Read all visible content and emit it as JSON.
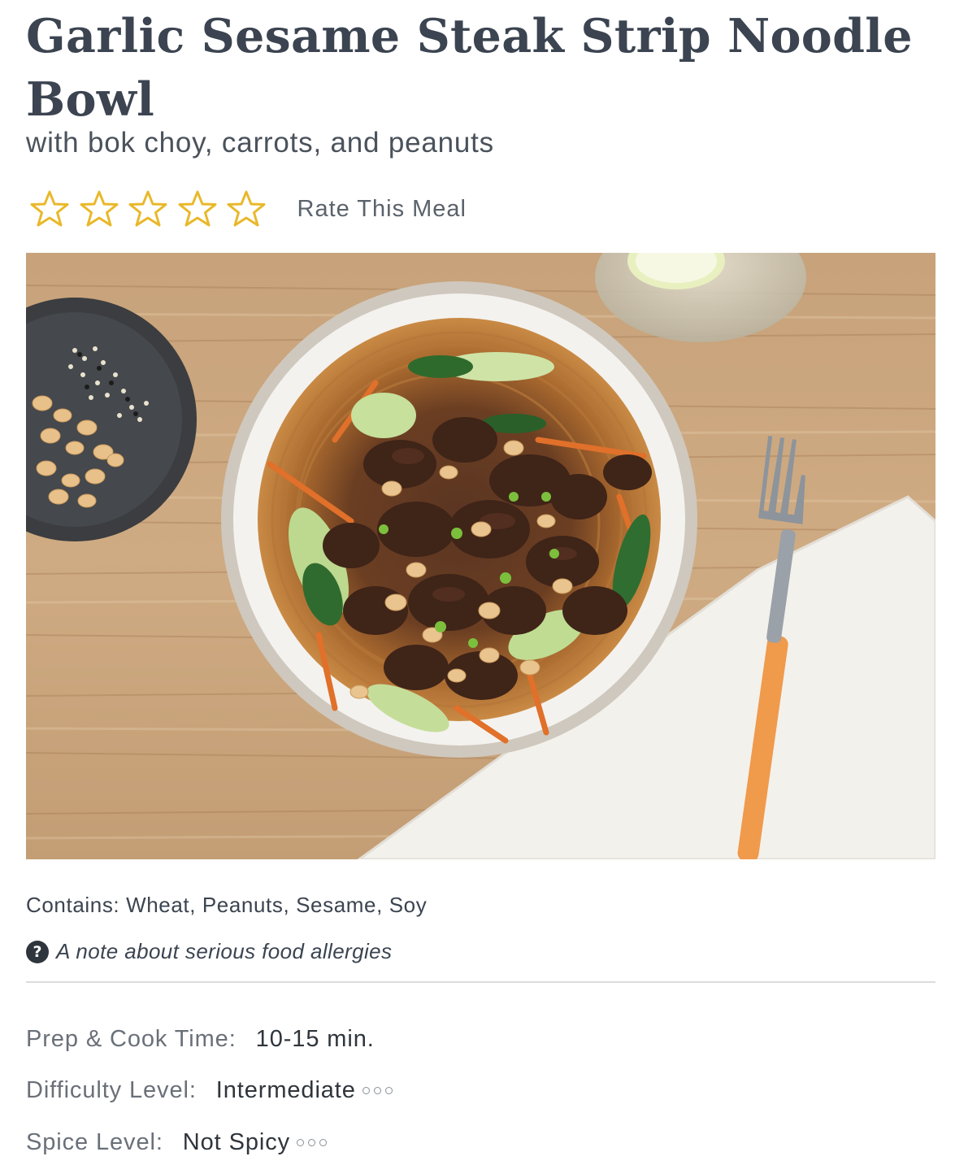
{
  "meal": {
    "title": "Garlic Sesame Steak Strip Noodle Bowl",
    "subtitle": "with bok choy, carrots, and peanuts"
  },
  "rating": {
    "stars": 5,
    "selected": 0,
    "label": "Rate This Meal",
    "star_color": "#e9b82a"
  },
  "allergens": {
    "contains": "Contains: Wheat, Peanuts, Sesame, Soy",
    "note_link": "A note about serious food allergies",
    "note_icon": "question-circle-icon"
  },
  "details": {
    "prep_label": "Prep & Cook Time:",
    "prep_value": "10-15 min.",
    "difficulty_label": "Difficulty Level:",
    "difficulty_value": "Intermediate",
    "spice_label": "Spice Level:",
    "spice_value": "Not Spicy"
  }
}
